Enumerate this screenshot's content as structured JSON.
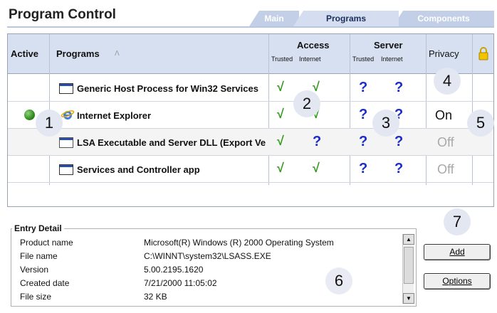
{
  "header": {
    "title": "Program Control",
    "tabs": [
      {
        "label": "Main",
        "active": false
      },
      {
        "label": "Programs",
        "active": true
      },
      {
        "label": "Components",
        "active": false
      }
    ]
  },
  "table": {
    "columns": {
      "active": "Active",
      "programs": "Programs",
      "sort_indicator": "Ʌ",
      "access": "Access",
      "server": "Server",
      "trusted": "Trusted",
      "internet": "Internet",
      "privacy": "Privacy"
    },
    "rows": [
      {
        "active": false,
        "name": "Generic Host Process for Win32 Services",
        "access_trusted": "√",
        "access_internet": "√",
        "server_trusted": "?",
        "server_internet": "?",
        "privacy": ""
      },
      {
        "active": true,
        "name": "Internet Explorer",
        "access_trusted": "√",
        "access_internet": "√",
        "server_trusted": "?",
        "server_internet": "?",
        "privacy": "On"
      },
      {
        "active": false,
        "name": "LSA Executable and Server DLL (Export Version)",
        "access_trusted": "√",
        "access_internet": "?",
        "server_trusted": "?",
        "server_internet": "?",
        "privacy": "Off"
      },
      {
        "active": false,
        "name": "Services and Controller app",
        "access_trusted": "√",
        "access_internet": "√",
        "server_trusted": "?",
        "server_internet": "?",
        "privacy": "Off"
      }
    ]
  },
  "callouts": [
    "1",
    "2",
    "3",
    "4",
    "5",
    "6",
    "7"
  ],
  "entry_detail": {
    "legend": "Entry Detail",
    "fields": [
      {
        "label": "Product name",
        "value": "Microsoft(R) Windows (R) 2000 Operating System"
      },
      {
        "label": "File name",
        "value": "C:\\WINNT\\system32\\LSASS.EXE"
      },
      {
        "label": "Version",
        "value": "5.00.2195.1620"
      },
      {
        "label": "Created date",
        "value": "7/21/2000 11:05:02"
      },
      {
        "label": "File size",
        "value": "32 KB"
      }
    ]
  },
  "buttons": {
    "add": "Add",
    "options": "Options"
  },
  "colors": {
    "check": "#2f9a1a",
    "question": "#1a2ccc",
    "header_bg": "#d7e0f0",
    "tab_bg": "#c2cfe6",
    "active_dot": "#2f8b1d"
  },
  "icons": {
    "lock": "lock-icon",
    "ie": "internet-explorer-icon",
    "window": "program-window-icon"
  }
}
